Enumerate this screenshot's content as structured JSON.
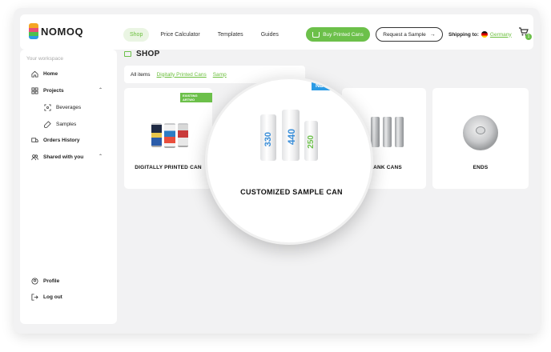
{
  "logo": {
    "text": "NOMOQ"
  },
  "nav": {
    "items": [
      {
        "label": "Shop",
        "active": true
      },
      {
        "label": "Price Calculator"
      },
      {
        "label": "Templates"
      },
      {
        "label": "Guides"
      }
    ]
  },
  "header": {
    "buy_button": "Buy Printed Cans",
    "sample_button": "Request a Sample",
    "shipping_label": "Shipping to:",
    "shipping_country": "Germany",
    "cart_count": "1"
  },
  "sidebar": {
    "workspace_label": "Your workspace",
    "items": {
      "home": "Home",
      "projects": "Projects",
      "beverages": "Beverages",
      "samples": "Samples",
      "orders": "Orders History",
      "shared": "Shared with you",
      "profile": "Profile",
      "logout": "Log out"
    }
  },
  "content": {
    "title": "SHOP",
    "filters": [
      "All items",
      "Digitally Printed Cans",
      "Samp"
    ],
    "cards": {
      "digital": "DIGITALLY PRINTED CAN",
      "digital_tag": "EXISTING ARTWO",
      "blank": "BLANK CANS",
      "ends": "ENDS"
    },
    "magnifier": {
      "tag": "NEW AR",
      "label": "CUSTOMIZED SAMPLE CAN",
      "can_numbers": [
        "330",
        "440",
        "250"
      ],
      "can_colors": [
        "#3b8fd9",
        "#3b8fd9",
        "#6cc04a"
      ]
    }
  },
  "colors": {
    "accent": "#6cc04a",
    "blue_tag": "#2b9be5"
  }
}
